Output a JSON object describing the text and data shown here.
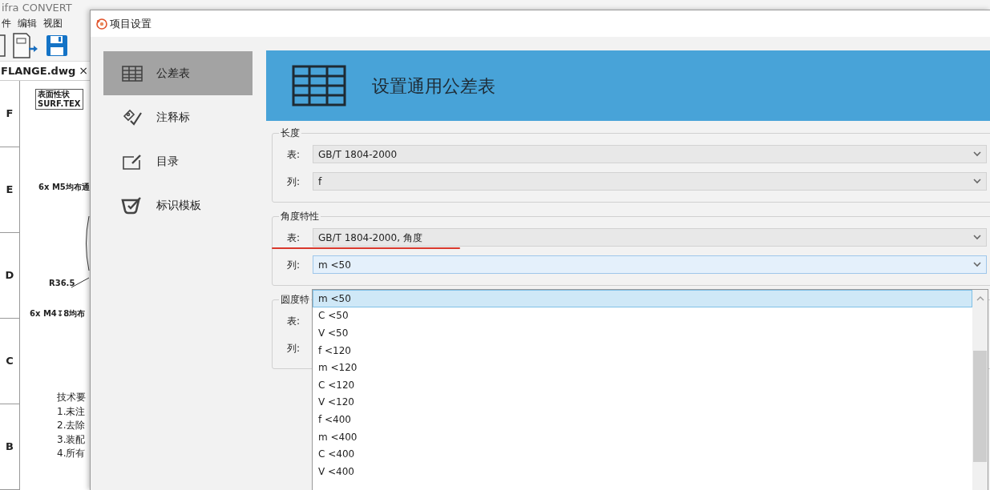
{
  "background_app": {
    "title": "ifra CONVERT",
    "menu": [
      "件",
      "编辑",
      "视图"
    ],
    "document_tab": {
      "label": "FLANGE.dwg",
      "close": "×"
    },
    "drawing": {
      "row_labels": [
        "F",
        "E",
        "D",
        "C",
        "B"
      ],
      "surface_label": [
        "表面性状",
        "SURF.TEX"
      ],
      "notes": [
        "6x M5均布通",
        "R36.5",
        "6x M4↧8均布"
      ],
      "requirements": [
        "技术要",
        "1.未注",
        "2.去除",
        "3.装配",
        "4.所有"
      ]
    }
  },
  "dialog": {
    "title": "项目设置",
    "sidebar": [
      {
        "label": "公差表",
        "selected": true
      },
      {
        "label": "注释标",
        "selected": false
      },
      {
        "label": "目录",
        "selected": false
      },
      {
        "label": "标识模板",
        "selected": false
      }
    ],
    "header": "设置通用公差表",
    "groups": [
      {
        "title": "长度",
        "fields": [
          {
            "label": "表:",
            "value": "GB/T 1804-2000",
            "focused": false,
            "underlined": false
          },
          {
            "label": "列:",
            "value": "f",
            "focused": false,
            "underlined": false
          }
        ]
      },
      {
        "title": "角度特性",
        "fields": [
          {
            "label": "表:",
            "value": "GB/T 1804-2000, 角度",
            "focused": false,
            "underlined": true
          },
          {
            "label": "列:",
            "value": "m <50",
            "focused": true,
            "underlined": false
          }
        ]
      },
      {
        "title": "圆度特",
        "fields": [
          {
            "label": "表:",
            "underlined": false
          },
          {
            "label": "列:",
            "underlined": false
          }
        ]
      }
    ],
    "dropdown": {
      "items": [
        {
          "label": "m <50",
          "selected": true
        },
        {
          "label": "C <50",
          "selected": false
        },
        {
          "label": "V <50",
          "selected": false
        },
        {
          "label": "f <120",
          "selected": false
        },
        {
          "label": "m <120",
          "selected": false
        },
        {
          "label": "C <120",
          "selected": false
        },
        {
          "label": "V <120",
          "selected": false
        },
        {
          "label": "f <400",
          "selected": false
        },
        {
          "label": "m <400",
          "selected": false
        },
        {
          "label": "C <400",
          "selected": false
        },
        {
          "label": "V <400",
          "selected": false
        }
      ]
    }
  }
}
